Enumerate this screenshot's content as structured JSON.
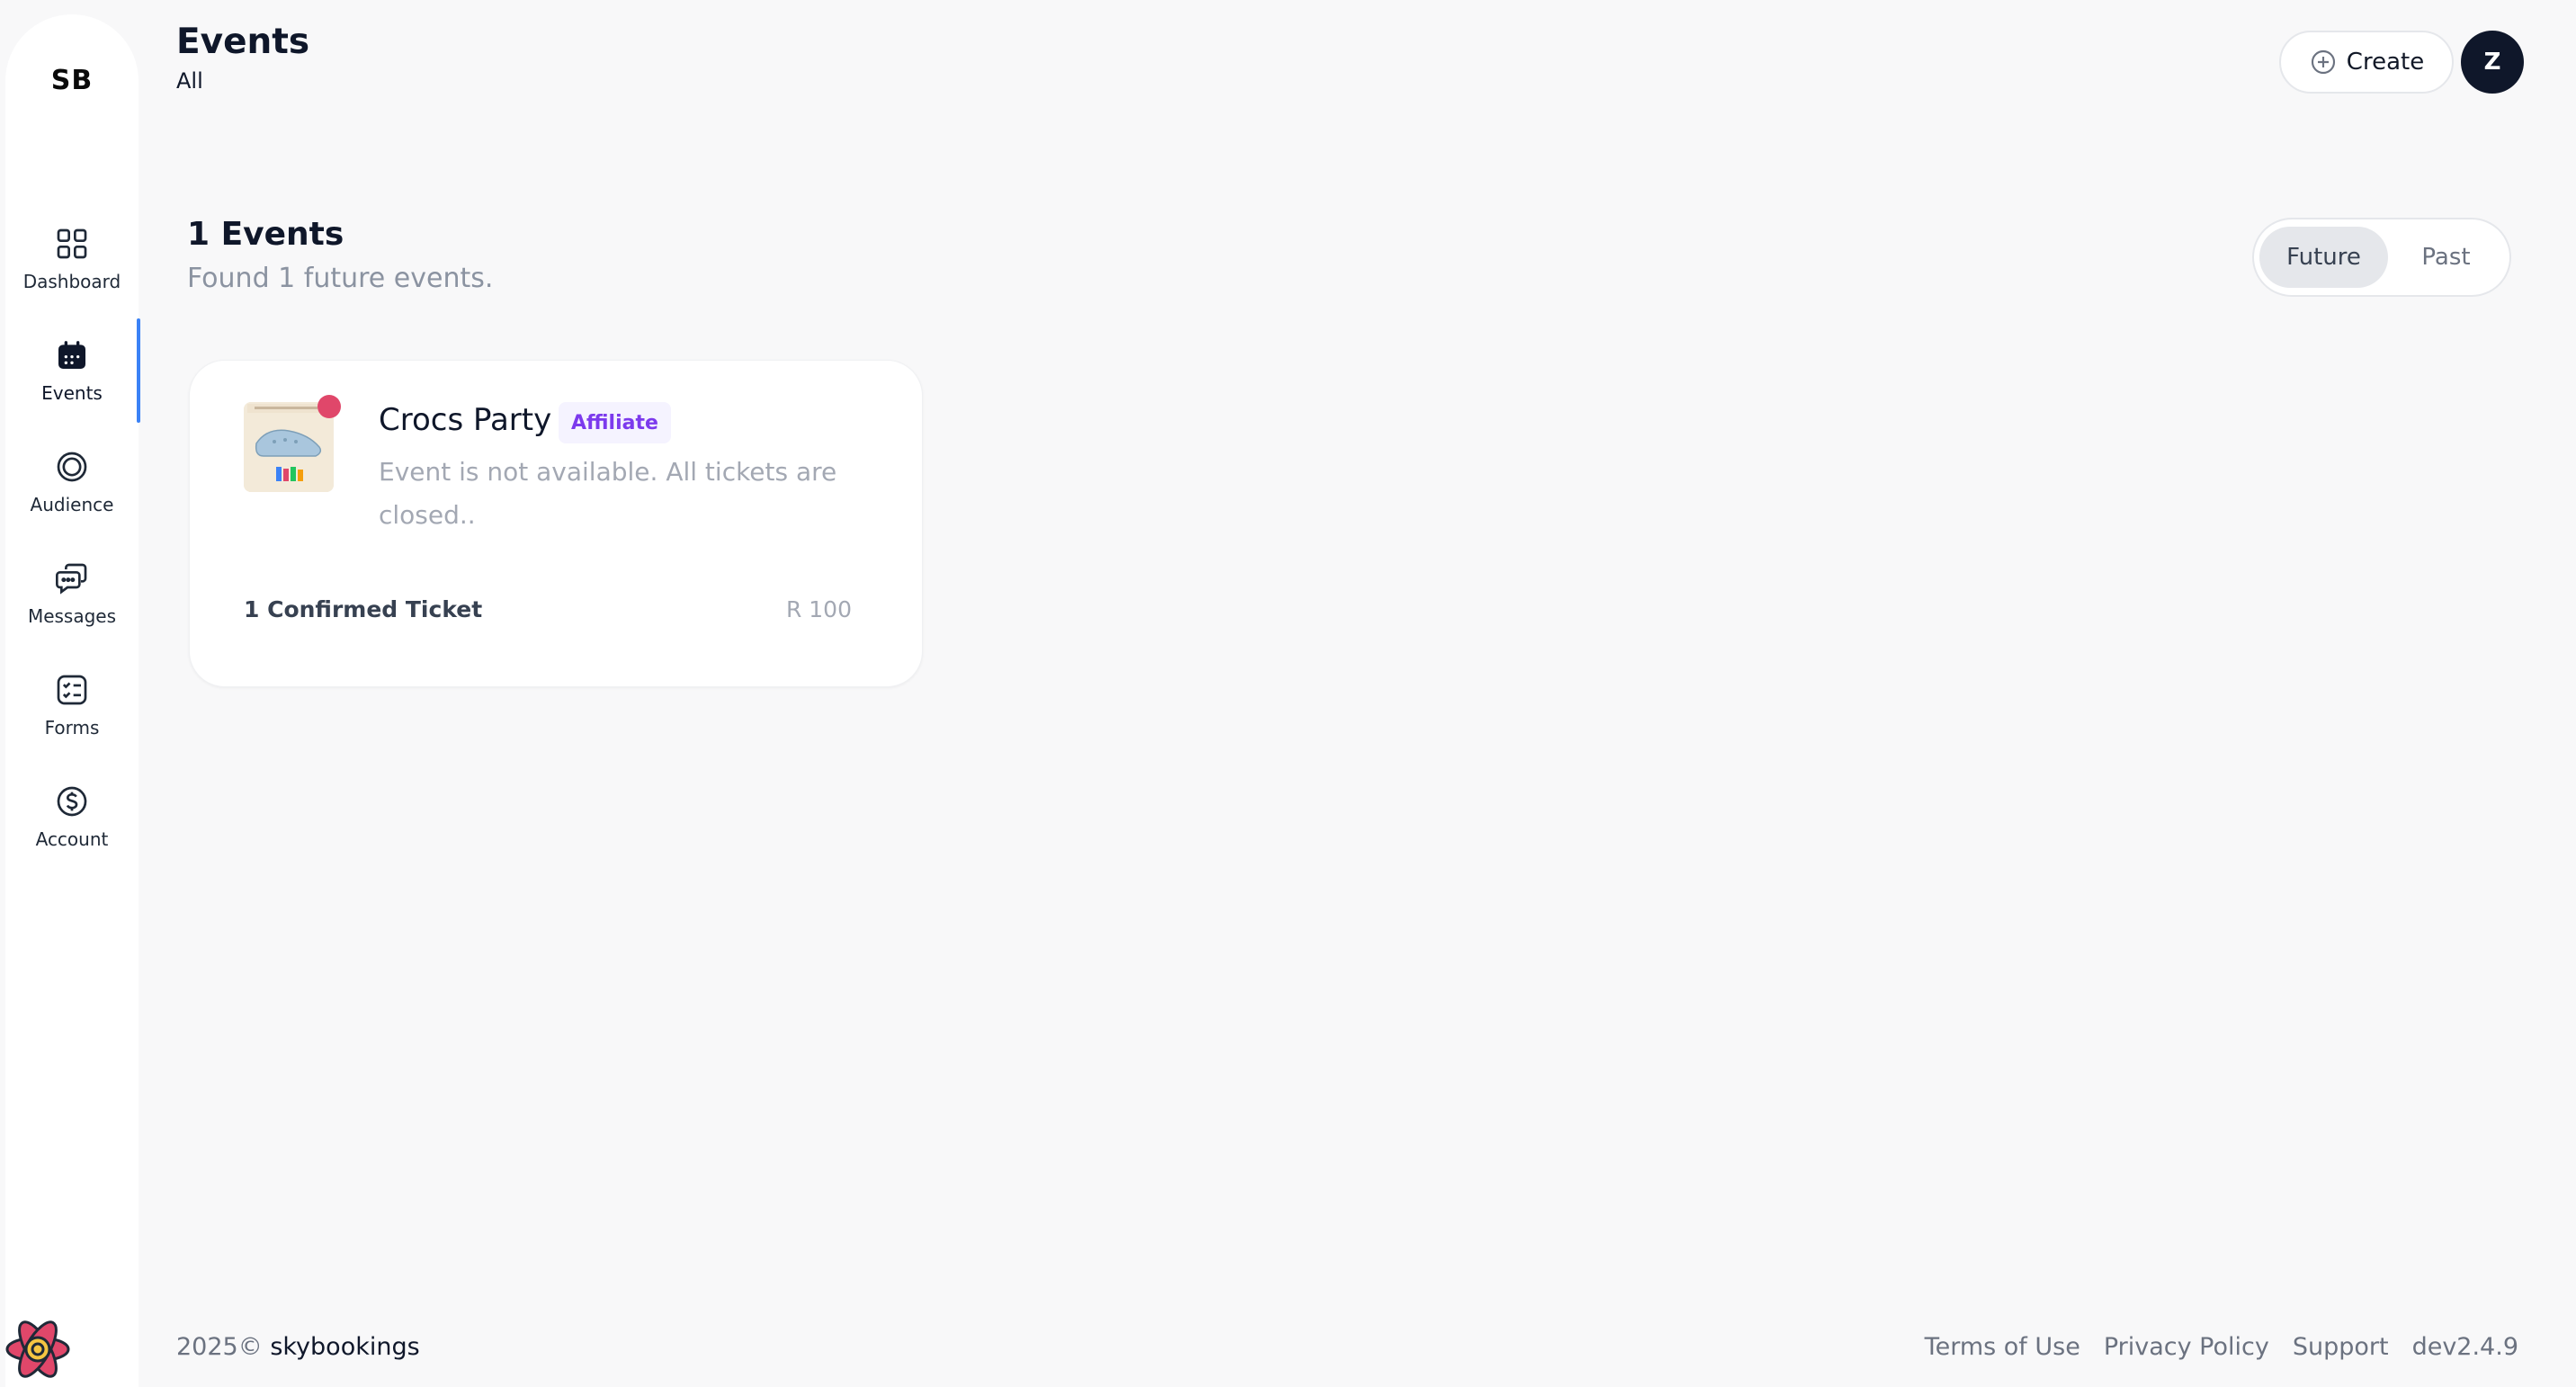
{
  "sidebar": {
    "brand": "SB",
    "items": [
      {
        "label": "Dashboard",
        "icon": "grid-icon"
      },
      {
        "label": "Events",
        "icon": "calendar-icon",
        "active": true
      },
      {
        "label": "Audience",
        "icon": "target-icon"
      },
      {
        "label": "Messages",
        "icon": "chat-icon"
      },
      {
        "label": "Forms",
        "icon": "checklist-icon"
      },
      {
        "label": "Account",
        "icon": "dollar-icon"
      }
    ]
  },
  "header": {
    "title": "Events",
    "subtitle": "All",
    "create_label": "Create",
    "avatar_initial": "Z"
  },
  "main": {
    "count_title": "1 Events",
    "count_subtitle": "Found 1 future events.",
    "filter": {
      "options": [
        "Future",
        "Past"
      ],
      "selected": "Future"
    },
    "events": [
      {
        "name": "Crocs Party",
        "badge": "Affiliate",
        "description": "Event is not available. All tickets are closed..",
        "tickets": "1 Confirmed Ticket",
        "price": "R 100",
        "status_color": "#e0476a"
      }
    ]
  },
  "footer": {
    "year": "2025©",
    "brand": "skybookings",
    "links": [
      "Terms of Use",
      "Privacy Policy",
      "Support"
    ],
    "version": "dev2.4.9"
  },
  "colors": {
    "accent": "#3b82f6",
    "badge_text": "#7c3aed",
    "status_dot": "#e0476a",
    "dark": "#0f172a"
  }
}
